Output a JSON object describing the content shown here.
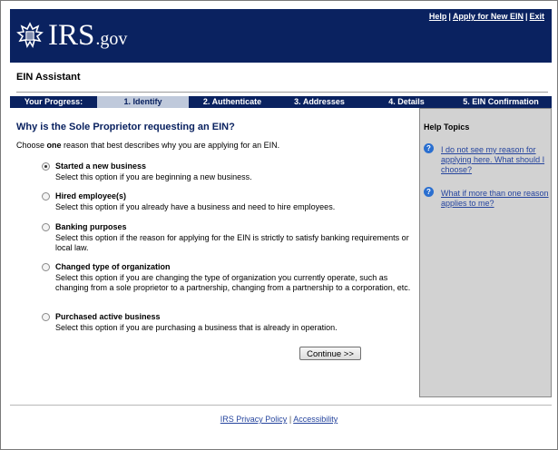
{
  "header": {
    "logo_text": "IRS",
    "logo_suffix": ".gov",
    "links": {
      "help": "Help",
      "apply": "Apply for New EIN",
      "exit": "Exit",
      "separator": "|"
    }
  },
  "page_title": "EIN Assistant",
  "progress": {
    "label": "Your Progress:",
    "steps": [
      "1. Identify",
      "2. Authenticate",
      "3. Addresses",
      "4. Details",
      "5. EIN Confirmation"
    ],
    "current_step": 1
  },
  "question": "Why is the Sole Proprietor requesting an EIN?",
  "instruction": {
    "prefix": "Choose ",
    "emphasis": "one",
    "suffix": " reason that best describes why you are applying for an EIN."
  },
  "options": [
    {
      "title": "Started a new business",
      "desc": "Select this option if you are beginning a new business.",
      "selected": true
    },
    {
      "title": "Hired employee(s)",
      "desc": "Select this option if you already have a business and need to hire employees.",
      "selected": false
    },
    {
      "title": "Banking purposes",
      "desc": "Select this option if the reason for applying for the EIN is strictly to satisfy banking requirements or local law.",
      "selected": false
    },
    {
      "title": "Changed type of organization",
      "desc": "Select this option if you are changing the type of organization you currently operate, such as changing from a sole proprietor to a partnership, changing from a partnership to a corporation, etc.",
      "selected": false
    },
    {
      "title": "Purchased active business",
      "desc": "Select this option if you are purchasing a business that is already in operation.",
      "selected": false
    }
  ],
  "continue_label": "Continue >>",
  "help": {
    "title": "Help Topics",
    "icon_glyph": "?",
    "items": [
      "I do not see my reason for applying here. What should I choose?",
      "What if more than one reason applies to me?"
    ]
  },
  "footer": {
    "privacy": "IRS Privacy Policy",
    "separator": "|",
    "accessibility": "Accessibility"
  },
  "colors": {
    "navy": "#0a2260",
    "step_active": "#bfc9db",
    "help_bg": "#d2d2d2",
    "link": "#26459e",
    "help_icon": "#2a6fd0"
  },
  "icons": {
    "logo": "irs-eagle-logo",
    "radio": "radio-button",
    "help": "question-icon"
  }
}
